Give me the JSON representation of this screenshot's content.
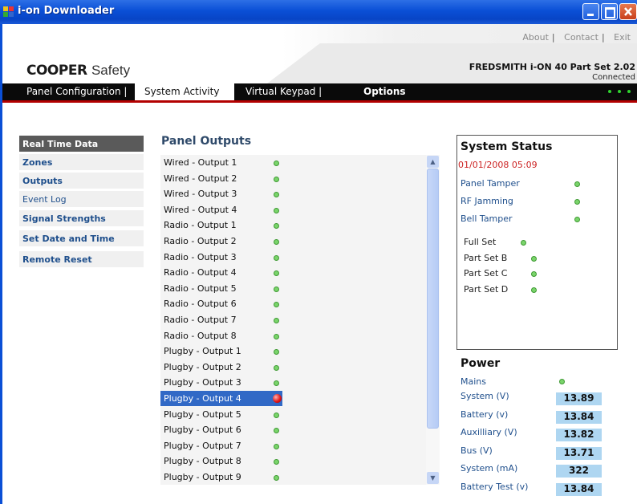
{
  "window": {
    "title": "i-on Downloader"
  },
  "header": {
    "links": [
      "About",
      "Contact",
      "Exit"
    ],
    "logo_brand": "COOPER",
    "logo_suffix": "Safety",
    "panel_id": "FREDSMITH i-ON 40 Part Set 2.02",
    "connection_status": "Connected"
  },
  "nav": {
    "tabs": [
      {
        "label": "Panel Configuration |"
      },
      {
        "label": "System Activity"
      },
      {
        "label": "Virtual Keypad |"
      },
      {
        "label": "Options"
      }
    ],
    "active_tab": "System Activity"
  },
  "sidebar": {
    "items": [
      {
        "label": "Real Time Data"
      },
      {
        "label": "Zones"
      },
      {
        "label": "Outputs"
      },
      {
        "label": "Event Log"
      },
      {
        "label": "Signal Strengths"
      },
      {
        "label": "Set Date and Time"
      },
      {
        "label": "Remote Reset"
      }
    ],
    "active": "Real Time Data"
  },
  "outputs": {
    "title": "Panel Outputs",
    "items": [
      {
        "label": "Wired - Output 1",
        "state": "off"
      },
      {
        "label": "Wired - Output 2",
        "state": "off"
      },
      {
        "label": "Wired - Output 3",
        "state": "off"
      },
      {
        "label": "Wired - Output 4",
        "state": "off"
      },
      {
        "label": "Radio - Output 1",
        "state": "off"
      },
      {
        "label": "Radio - Output 2",
        "state": "off"
      },
      {
        "label": "Radio - Output 3",
        "state": "off"
      },
      {
        "label": "Radio - Output 4",
        "state": "off"
      },
      {
        "label": "Radio - Output 5",
        "state": "off"
      },
      {
        "label": "Radio - Output 6",
        "state": "off"
      },
      {
        "label": "Radio - Output 7",
        "state": "off"
      },
      {
        "label": "Radio - Output 8",
        "state": "off"
      },
      {
        "label": "Plugby - Output 1",
        "state": "off"
      },
      {
        "label": "Plugby - Output 2",
        "state": "off"
      },
      {
        "label": "Plugby - Output 3",
        "state": "off"
      },
      {
        "label": "Plugby - Output 4",
        "state": "on"
      },
      {
        "label": "Plugby - Output 5",
        "state": "off"
      },
      {
        "label": "Plugby - Output 6",
        "state": "off"
      },
      {
        "label": "Plugby - Output 7",
        "state": "off"
      },
      {
        "label": "Plugby - Output 8",
        "state": "off"
      },
      {
        "label": "Plugby - Output 9",
        "state": "off"
      }
    ],
    "selected": "Plugby - Output 4"
  },
  "system_status": {
    "title": "System Status",
    "datetime": "01/01/2008 05:09",
    "alerts": [
      {
        "label": "Panel Tamper",
        "state": "ok"
      },
      {
        "label": "RF Jamming",
        "state": "ok"
      },
      {
        "label": "Bell Tamper",
        "state": "ok"
      }
    ],
    "set_modes": [
      {
        "label": "Full Set",
        "state": "off"
      },
      {
        "label": "Part Set B",
        "state": "off"
      },
      {
        "label": "Part Set C",
        "state": "off"
      },
      {
        "label": "Part Set D",
        "state": "off"
      }
    ]
  },
  "power": {
    "title": "Power",
    "mains_label": "Mains",
    "mains_state": "ok",
    "readings": [
      {
        "label": "System (V)",
        "value": "13.89"
      },
      {
        "label": "Battery (v)",
        "value": "13.84"
      },
      {
        "label": "Auxilliary (V)",
        "value": "13.82"
      },
      {
        "label": "Bus (V)",
        "value": "13.71"
      },
      {
        "label": "System (mA)",
        "value": "322"
      },
      {
        "label": "Battery Test (v)",
        "value": "13.84"
      }
    ]
  },
  "colors": {
    "accent_green": "#7ad46b",
    "alert_red": "#e01818",
    "selection_blue": "#3169c6",
    "value_bg": "#aed6f1",
    "datetime_red": "#cc2222"
  }
}
